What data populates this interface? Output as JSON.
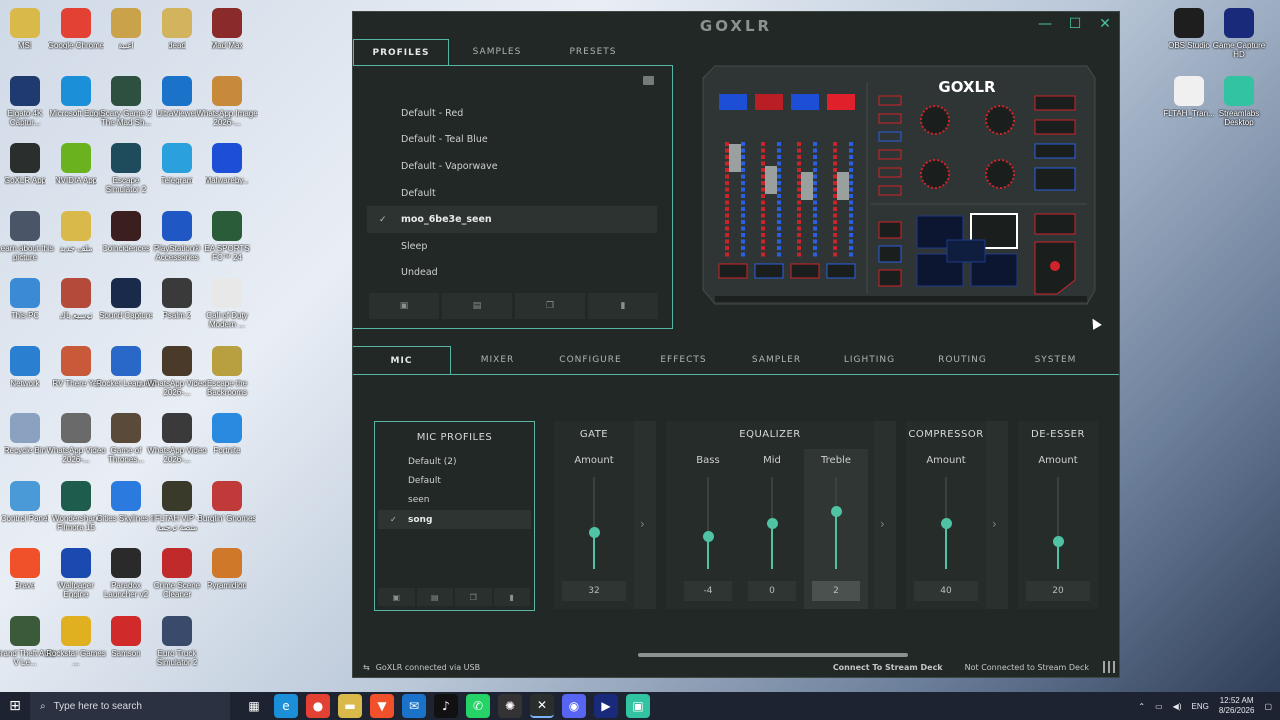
{
  "desktop": {
    "icons_left": [
      {
        "label": "MSI",
        "icon": "folder-icon",
        "color": "#d9b94a"
      },
      {
        "label": "Google Chrome",
        "icon": "chrome-icon",
        "color": "#e34133"
      },
      {
        "label": "اغنية",
        "icon": "file-icon",
        "color": "#c9a24a"
      },
      {
        "label": "dead",
        "icon": "file-icon",
        "color": "#d2b35e"
      },
      {
        "label": "Mad Max",
        "icon": "game-icon",
        "color": "#8a2a2a"
      },
      {
        "label": "Elgato 4K Captur...",
        "icon": "elgato-icon",
        "color": "#1e3a6e"
      },
      {
        "label": "Microsoft Edge",
        "icon": "edge-icon",
        "color": "#1b8fd8"
      },
      {
        "label": "Scary Game 2 The Mad Sh...",
        "icon": "game-icon",
        "color": "#2e5040"
      },
      {
        "label": "UltraViewer",
        "icon": "viewer-icon",
        "color": "#1a73c8"
      },
      {
        "label": "WhatsApp Image 2026-...",
        "icon": "image-icon",
        "color": "#c68a3a"
      },
      {
        "label": "GoXLR App",
        "icon": "goxlr-icon",
        "color": "#2a2f2d"
      },
      {
        "label": "NVIDIA App",
        "icon": "nvidia-icon",
        "color": "#6bb31e"
      },
      {
        "label": "Escape Simulator 2",
        "icon": "game-icon",
        "color": "#1f4c5c"
      },
      {
        "label": "Telegram",
        "icon": "telegram-icon",
        "color": "#2aa0dc"
      },
      {
        "label": "Malwareby...",
        "icon": "malwarebytes-icon",
        "color": "#1d4fd6"
      },
      {
        "label": "Learn about this picture",
        "icon": "info-icon",
        "color": "#4a5668"
      },
      {
        "label": "ملف جديد",
        "icon": "folder-icon",
        "color": "#d9b94a"
      },
      {
        "label": "Coincidences",
        "icon": "game-icon",
        "color": "#3b1e1e"
      },
      {
        "label": "PlayStation® Accessories",
        "icon": "playstation-icon",
        "color": "#1f57c4"
      },
      {
        "label": "EA SPORTS FC™ 24",
        "icon": "game-icon",
        "color": "#2a5c3a"
      },
      {
        "label": "This PC",
        "icon": "pc-icon",
        "color": "#3a8ad6"
      },
      {
        "label": "توسيع باك",
        "icon": "file-icon",
        "color": "#b34a3a"
      },
      {
        "label": "Sound Capture",
        "icon": "sound-icon",
        "color": "#1a2a4a"
      },
      {
        "label": "Psalm 2",
        "icon": "game-icon",
        "color": "#3a3a3a"
      },
      {
        "label": "Call of Duty Modern ...",
        "icon": "file-icon",
        "color": "#e8e8e8"
      },
      {
        "label": "Network",
        "icon": "network-icon",
        "color": "#2a7fd0"
      },
      {
        "label": "RV There Yet",
        "icon": "game-icon",
        "color": "#c85a3a"
      },
      {
        "label": "Rocket League®",
        "icon": "game-icon",
        "color": "#2a68c8"
      },
      {
        "label": "WhatsApp Video 2026-...",
        "icon": "video-icon",
        "color": "#4a3a2a"
      },
      {
        "label": "Escape the Backrooms",
        "icon": "game-icon",
        "color": "#b8a040"
      },
      {
        "label": "Recycle Bin",
        "icon": "recycle-icon",
        "color": "#8aa2c0"
      },
      {
        "label": "WhatsApp Video 2026-...",
        "icon": "video-icon",
        "color": "#6a6a6a"
      },
      {
        "label": "Game of Thrones...",
        "icon": "game-icon",
        "color": "#5a4a3a"
      },
      {
        "label": "WhatsApp Video 2026-...",
        "icon": "video-icon",
        "color": "#3a3a3a"
      },
      {
        "label": "Fortnite",
        "icon": "fortnite-icon",
        "color": "#2a8ae0"
      },
      {
        "label": "Control Panel",
        "icon": "control-panel-icon",
        "color": "#4a9ad8"
      },
      {
        "label": "Wondershare Filmora 15",
        "icon": "filmora-icon",
        "color": "#1e5c4e"
      },
      {
        "label": "Cities Skylines II",
        "icon": "game-icon",
        "color": "#2a7ae0"
      },
      {
        "label": "FLTAH VIP - منصة ترجمة",
        "icon": "file-icon",
        "color": "#3a3a2a"
      },
      {
        "label": "Burglin' Gnomes",
        "icon": "game-icon",
        "color": "#c03a3a"
      },
      {
        "label": "Brave",
        "icon": "brave-icon",
        "color": "#f0502a"
      },
      {
        "label": "Wallpaper Engine",
        "icon": "wallpaper-icon",
        "color": "#1a4ab0"
      },
      {
        "label": "Paradox Launcher v2",
        "icon": "paradox-icon",
        "color": "#2a2a2a"
      },
      {
        "label": "Crime Scene Cleaner",
        "icon": "game-icon",
        "color": "#c02a2a"
      },
      {
        "label": "Pyramidion",
        "icon": "game-icon",
        "color": "#d0782a"
      },
      {
        "label": "Grand Theft Auto V Le...",
        "icon": "gta-icon",
        "color": "#3a5a3a"
      },
      {
        "label": "Rockstar Games ...",
        "icon": "rockstar-icon",
        "color": "#e0b020"
      },
      {
        "label": "Samson",
        "icon": "game-icon",
        "color": "#d02a2a"
      },
      {
        "label": "Euro Truck Simulator 2",
        "icon": "game-icon",
        "color": "#3a4a6a"
      }
    ],
    "icons_right": [
      {
        "label": "OBS Studio",
        "icon": "obs-icon",
        "color": "#1e1e1e"
      },
      {
        "label": "Game Capture HD",
        "icon": "play-icon",
        "color": "#1a2a7a"
      },
      {
        "label": "FLTAH_Tran...",
        "icon": "file-icon",
        "color": "#f0f0f0"
      },
      {
        "label": "Streamlabs Desktop",
        "icon": "streamlabs-icon",
        "color": "#31c3a2"
      }
    ]
  },
  "window": {
    "title": "GOXLR",
    "accent": "#56b6a2",
    "controls": {
      "minimize": "—",
      "maximize": "☐",
      "close": "✕"
    }
  },
  "top_tabs": [
    {
      "label": "PROFILES",
      "active": true
    },
    {
      "label": "SAMPLES",
      "active": false
    },
    {
      "label": "PRESETS",
      "active": false
    }
  ],
  "profiles": [
    {
      "name": "Default - Red",
      "selected": false
    },
    {
      "name": "Default - Teal Blue",
      "selected": false
    },
    {
      "name": "Default - Vaporwave",
      "selected": false
    },
    {
      "name": "Default",
      "selected": false
    },
    {
      "name": "moo_6be3e_seen",
      "selected": true
    },
    {
      "name": "Sleep",
      "selected": false
    },
    {
      "name": "Undead",
      "selected": false
    }
  ],
  "profile_actions": [
    "save-icon",
    "save-as-icon",
    "copy-icon",
    "delete-icon"
  ],
  "device": {
    "brand": "GOXLR"
  },
  "bottom_tabs": [
    {
      "label": "MIC",
      "active": true
    },
    {
      "label": "MIXER",
      "active": false
    },
    {
      "label": "CONFIGURE",
      "active": false
    },
    {
      "label": "EFFECTS",
      "active": false
    },
    {
      "label": "SAMPLER",
      "active": false
    },
    {
      "label": "LIGHTING",
      "active": false
    },
    {
      "label": "ROUTING",
      "active": false
    },
    {
      "label": "SYSTEM",
      "active": false
    }
  ],
  "mic_profiles": {
    "title": "MIC PROFILES",
    "items": [
      {
        "name": "Default (2)",
        "selected": false
      },
      {
        "name": "Default",
        "selected": false
      },
      {
        "name": "seen",
        "selected": false
      },
      {
        "name": "song",
        "selected": true
      }
    ]
  },
  "gate": {
    "title": "GATE",
    "label": "Amount",
    "value": "32",
    "level": 0.4
  },
  "equalizer": {
    "title": "EQUALIZER",
    "bands": [
      {
        "label": "Bass",
        "value": "-4",
        "level": 0.35,
        "highlight": false
      },
      {
        "label": "Mid",
        "value": "0",
        "level": 0.5,
        "highlight": false
      },
      {
        "label": "Treble",
        "value": "2",
        "level": 0.62,
        "highlight": true
      }
    ]
  },
  "compressor": {
    "title": "COMPRESSOR",
    "label": "Amount",
    "value": "40",
    "level": 0.5
  },
  "deesser": {
    "title": "DE-ESSER",
    "label": "Amount",
    "value": "20",
    "level": 0.3
  },
  "status": {
    "connection": "GoXLR connected via USB",
    "stream_deck_link": "Connect To Stream Deck",
    "stream_deck_status": "Not Connected to Stream Deck"
  },
  "taskbar": {
    "search_placeholder": "Type here to search",
    "language": "ENG",
    "time": "12:52 AM",
    "date": "8/26/2026"
  }
}
